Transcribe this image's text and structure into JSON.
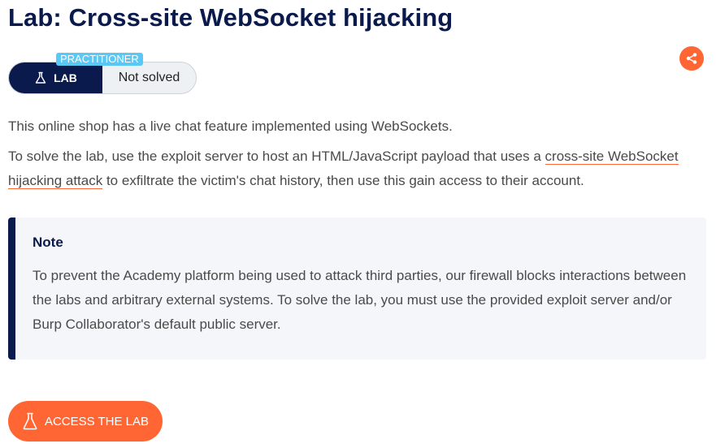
{
  "header": {
    "title": "Lab: Cross-site WebSocket hijacking"
  },
  "share": {
    "icon": "share-icon",
    "color": "#ff6633"
  },
  "lab_status": {
    "level_badge": "PRACTITIONER",
    "lab_label": "LAB",
    "lab_icon": "flask-icon",
    "status": "Not solved"
  },
  "description": {
    "paragraph1": "This online shop has a live chat feature implemented using WebSockets.",
    "paragraph2_before": "To solve the lab, use the exploit server to host an HTML/JavaScript payload that uses a ",
    "paragraph2_link": "cross-site WebSocket hijacking attack",
    "paragraph2_after": " to exfiltrate the victim's chat history, then use this gain access to their account."
  },
  "note": {
    "title": "Note",
    "text": "To prevent the Academy platform being used to attack third parties, our firewall blocks interactions between the labs and arbitrary external systems. To solve the lab, you must use the provided exploit server and/or Burp Collaborator's default public server."
  },
  "access_button": {
    "label": "ACCESS THE LAB",
    "icon": "flask-icon"
  },
  "colors": {
    "brand_navy": "#0a1a4d",
    "accent_orange": "#ff6633",
    "badge_blue": "#5ac8f5"
  }
}
